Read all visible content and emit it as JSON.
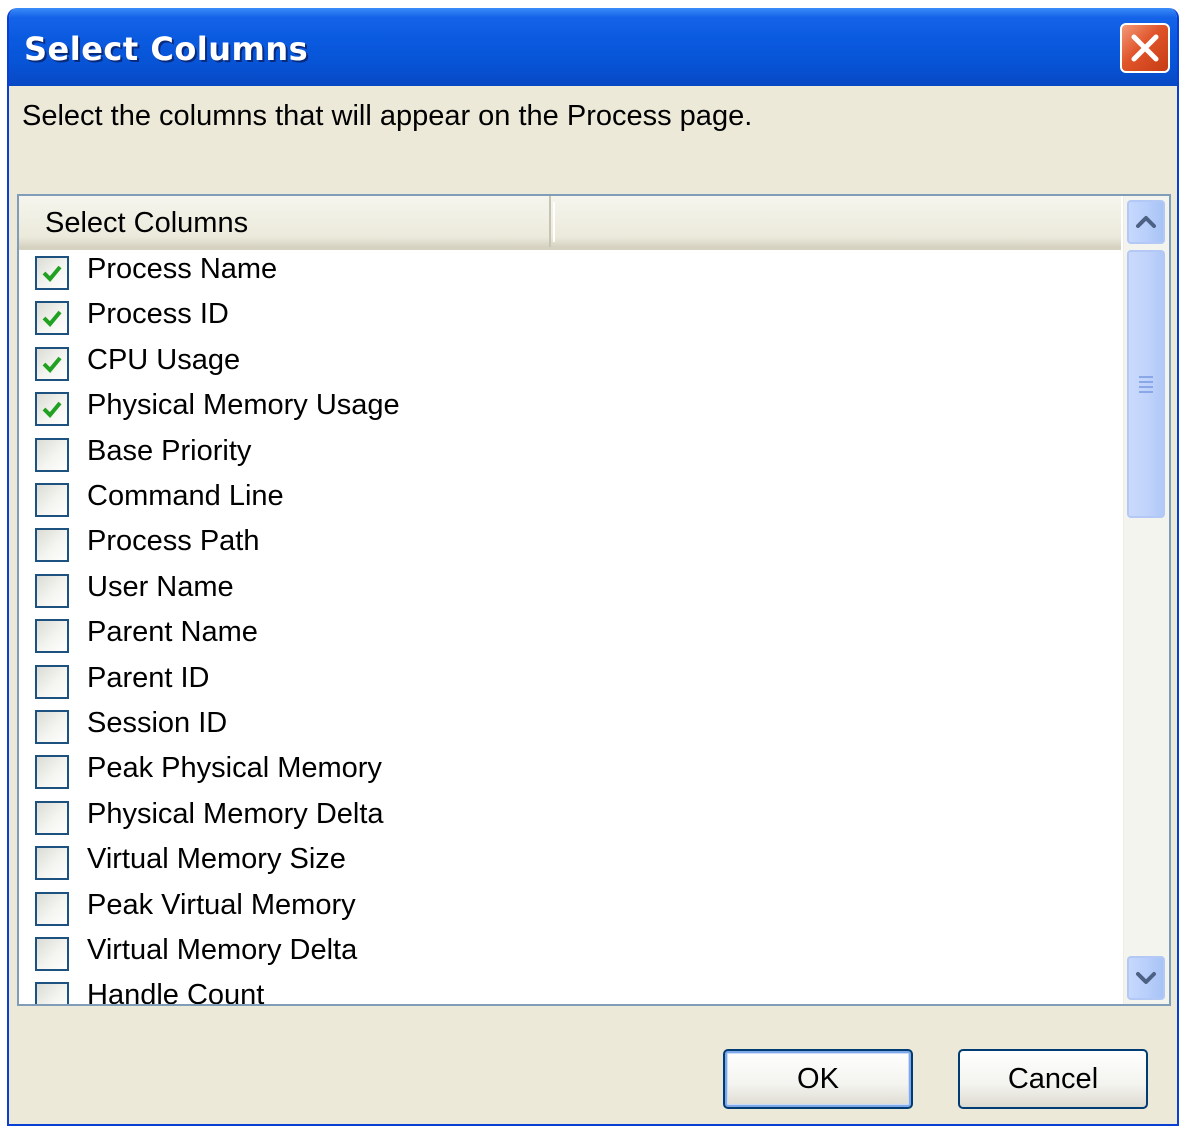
{
  "window": {
    "title": "Select Columns",
    "instruction": "Select the columns that will appear on the Process page."
  },
  "list": {
    "header": "Select Columns",
    "items": [
      {
        "label": "Process Name",
        "checked": true
      },
      {
        "label": "Process ID",
        "checked": true
      },
      {
        "label": "CPU Usage",
        "checked": true
      },
      {
        "label": "Physical Memory Usage",
        "checked": true
      },
      {
        "label": "Base Priority",
        "checked": false
      },
      {
        "label": "Command Line",
        "checked": false
      },
      {
        "label": "Process Path",
        "checked": false
      },
      {
        "label": "User Name",
        "checked": false
      },
      {
        "label": "Parent Name",
        "checked": false
      },
      {
        "label": "Parent ID",
        "checked": false
      },
      {
        "label": "Session ID",
        "checked": false
      },
      {
        "label": "Peak Physical Memory",
        "checked": false
      },
      {
        "label": "Physical Memory Delta",
        "checked": false
      },
      {
        "label": "Virtual Memory Size",
        "checked": false
      },
      {
        "label": "Peak Virtual Memory",
        "checked": false
      },
      {
        "label": "Virtual Memory Delta",
        "checked": false
      },
      {
        "label": "Handle Count",
        "checked": false
      }
    ]
  },
  "buttons": {
    "ok": "OK",
    "cancel": "Cancel"
  },
  "icons": {
    "close": "close-icon",
    "check": "checkmark-icon",
    "scroll_up": "chevron-up-icon",
    "scroll_down": "chevron-down-icon"
  },
  "colors": {
    "titlebar": "#0a5ae0",
    "dialog_bg": "#ece9d8",
    "check_mark": "#21a121",
    "close_button": "#e0542a"
  }
}
